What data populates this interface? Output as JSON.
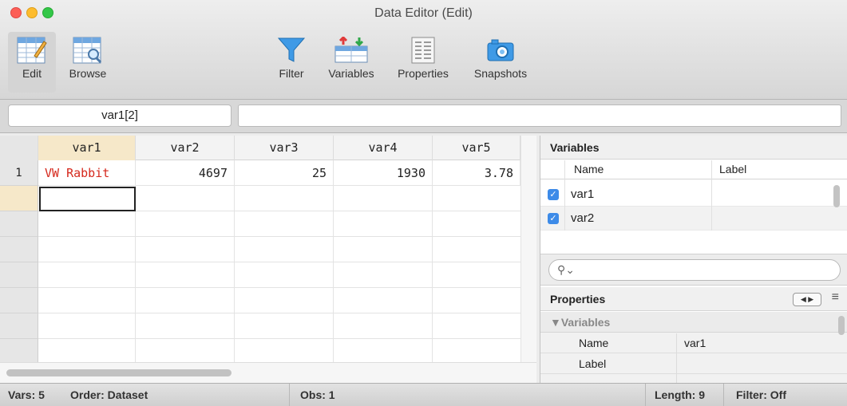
{
  "window": {
    "title": "Data Editor (Edit)"
  },
  "toolbar": {
    "edit": "Edit",
    "browse": "Browse",
    "filter": "Filter",
    "variables": "Variables",
    "properties": "Properties",
    "snapshots": "Snapshots"
  },
  "refbar": {
    "reference": "var1[2]",
    "command": ""
  },
  "grid": {
    "columns": [
      "var1",
      "var2",
      "var3",
      "var4",
      "var5"
    ],
    "rows": [
      {
        "n": "1",
        "cells": [
          "VW Rabbit",
          "4697",
          "25",
          "1930",
          "3.78"
        ]
      }
    ]
  },
  "variables_panel": {
    "title": "Variables",
    "col_name": "Name",
    "col_label": "Label",
    "items": [
      {
        "name": "var1",
        "label": "",
        "checked": true
      },
      {
        "name": "var2",
        "label": "",
        "checked": true
      }
    ]
  },
  "search": {
    "placeholder": ""
  },
  "properties_panel": {
    "title": "Properties",
    "group": "▼Variables",
    "rows": [
      {
        "key": "Name",
        "value": "var1"
      },
      {
        "key": "Label",
        "value": ""
      }
    ]
  },
  "statusbar": {
    "vars": "Vars: 5",
    "order": "Order: Dataset",
    "obs": "Obs: 1",
    "length": "Length: 9",
    "filter": "Filter: Off"
  },
  "colors": {
    "selected_header": "#f6e8c9",
    "string_value": "#d5281c",
    "checkbox": "#3d8be8"
  }
}
